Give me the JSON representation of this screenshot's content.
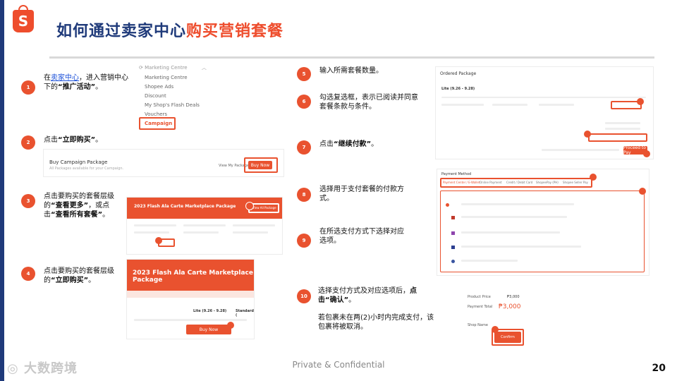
{
  "header": {
    "logo_letter": "S",
    "title_part1": "如何通过卖家中心",
    "title_part2": "购买营销套餐"
  },
  "steps": {
    "s1": {
      "num": "1",
      "pre": "在",
      "link": "卖家中心",
      "mid": "，进入营销中心下的",
      "bold": "“推广活动”",
      "post": "。"
    },
    "s2": {
      "num": "2",
      "pre": "点击",
      "bold": "“立即购买”",
      "post": "。"
    },
    "s3": {
      "num": "3",
      "pre": "点击要购买的套餐层级的",
      "bold1": "“查看更多”",
      "mid": "，或点击",
      "bold2": "“查看所有套餐”",
      "post": "。"
    },
    "s4": {
      "num": "4",
      "pre": "点击要购买的套餐层级的",
      "bold": "“立即购买”",
      "post": "。"
    },
    "s5": {
      "num": "5",
      "text": "输入所需套餐数量。"
    },
    "s6": {
      "num": "6",
      "text": "勾选复选框，表示已阅读并同意套餐条款与条件。"
    },
    "s7": {
      "num": "7",
      "pre": "点击",
      "bold": "“继续付款”",
      "post": "。"
    },
    "s8": {
      "num": "8",
      "text": "选择用于支付套餐的付款方式。"
    },
    "s9": {
      "num": "9",
      "text": "在所选支付方式下选择对应选项。"
    },
    "s10": {
      "num": "10",
      "pre": "选择支付方式及对应选项后，",
      "bold": "点击“确认”",
      "post": "。",
      "note": "若包裹未在两(2)小时内完成支付，该包裹将被取消。"
    }
  },
  "shot_menu": {
    "heading": "Marketing Centre",
    "items": [
      "Marketing Centre",
      "Shopee Ads",
      "Discount",
      "My Shop's Flash Deals",
      "Vouchers",
      "Campaign"
    ]
  },
  "shot_buy": {
    "title": "Buy Campaign Package",
    "subtitle": "All Packages available for your Campaign.",
    "link": "View My Package",
    "button": "Buy Now"
  },
  "shot_pkg": {
    "banner": "2023 Flash Ala Carte Marketplace Package",
    "view_all": "View All Package"
  },
  "shot_pkg2": {
    "banner": "2023 Flash Ala Carte Marketplace Package",
    "tier1": "Lite (9.26 - 9.28)",
    "tier2": "Standard (",
    "button": "Buy Now"
  },
  "shot_order": {
    "title": "Ordered Package",
    "tier": "Lite (9.26 - 9.28)",
    "proceed": "Proceed to Pay"
  },
  "shot_payment": {
    "title": "Payment Method",
    "tabs": [
      "Payment Center / E-Wallet",
      "Online Payment",
      "Credit / Debit Card",
      "ShopeePay (PH)",
      "Shopee Seller Pay"
    ]
  },
  "shot_confirm": {
    "price_label": "Product Price",
    "price_value": "₱3,000",
    "total_label": "Payment Total",
    "total_value": "₱3,000",
    "shop_label": "Shop Name",
    "button": "Confirm"
  },
  "footer": {
    "confidential": "Private & Confidential",
    "page": "20",
    "watermark": "大数跨境"
  },
  "colors": {
    "accent": "#ee4d2d",
    "navy": "#1f3a7a"
  }
}
